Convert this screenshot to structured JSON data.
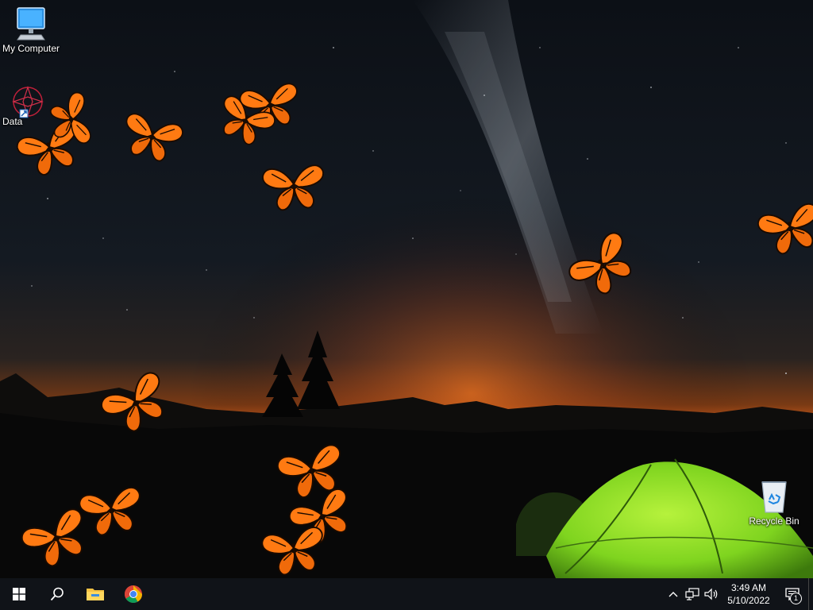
{
  "desktop": {
    "icons": [
      {
        "label": "My Computer",
        "icon": "monitor-icon"
      },
      {
        "label": "Data",
        "icon": "shortcut-icon"
      },
      {
        "label": "Recycle Bin",
        "icon": "recycle-bin-icon"
      }
    ]
  },
  "taskbar": {
    "start": {
      "icon": "windows-logo-icon"
    },
    "search": {
      "icon": "search-icon"
    },
    "pinned": [
      {
        "name": "File Explorer",
        "icon": "folder-icon"
      },
      {
        "name": "Google Chrome",
        "icon": "chrome-icon"
      }
    ],
    "tray": {
      "icons": [
        "chevron-up-icon",
        "network-icon",
        "volume-icon"
      ],
      "time": "3:49 AM",
      "date": "5/10/2022",
      "notification_count": "1"
    }
  },
  "colors": {
    "taskbar": "#101318",
    "butterfly": "#ff7a12",
    "tent": "#8ee02a",
    "horizon_glow": "#e8661a"
  }
}
